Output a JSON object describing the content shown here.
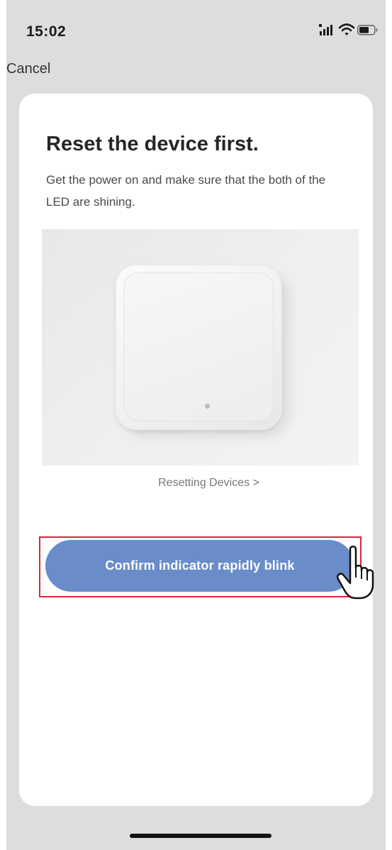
{
  "status_bar": {
    "time": "15:02",
    "icons": [
      "signal-icon",
      "wifi-icon",
      "battery-icon"
    ]
  },
  "nav": {
    "cancel_label": "Cancel"
  },
  "card": {
    "title": "Reset the device first.",
    "description": "Get the power on and make sure that the both of the LED are shining.",
    "illustration_icon": "smart-switch-device-image",
    "resetting_link": "Resetting Devices >",
    "confirm_button": "Confirm indicator rapidly blink"
  },
  "colors": {
    "background": "#dcdedd",
    "card": "#ffffff",
    "button": "#6a8dca",
    "highlight_border": "#e2233a"
  }
}
